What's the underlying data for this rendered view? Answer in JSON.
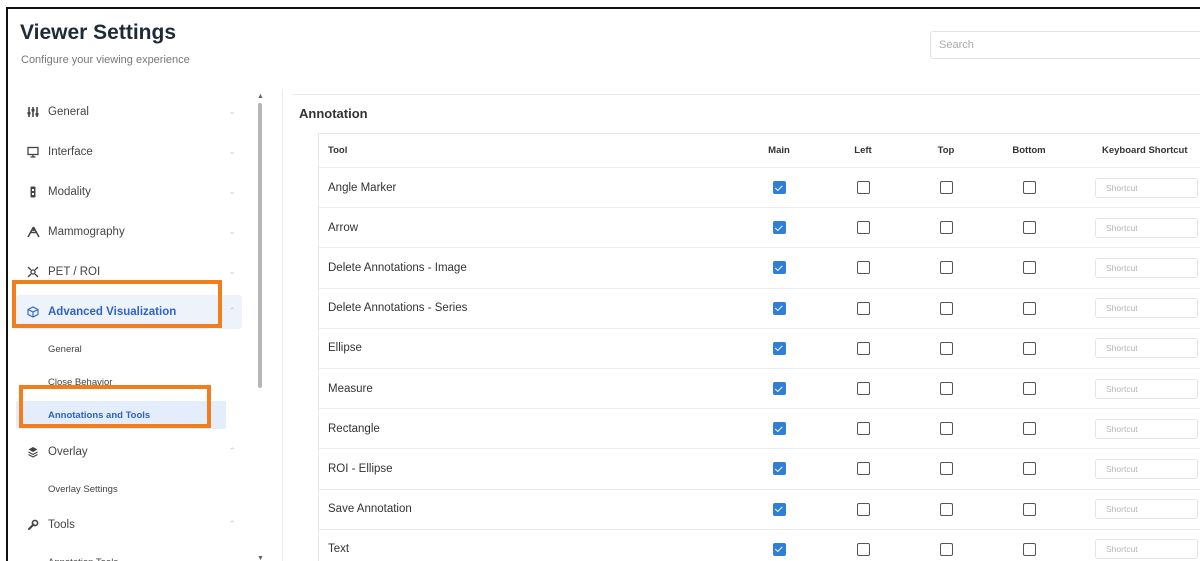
{
  "header": {
    "title": "Viewer Settings",
    "subtitle": "Configure your viewing experience",
    "search_placeholder": "Search"
  },
  "sidebar": {
    "items": [
      {
        "label": "General",
        "icon": "sliders-icon",
        "expanded": false
      },
      {
        "label": "Interface",
        "icon": "monitor-icon",
        "expanded": false
      },
      {
        "label": "Modality",
        "icon": "modality-icon",
        "expanded": false
      },
      {
        "label": "Mammography",
        "icon": "mammography-icon",
        "expanded": false
      },
      {
        "label": "PET / ROI",
        "icon": "pet-roi-icon",
        "expanded": false
      },
      {
        "label": "Advanced Visualization",
        "icon": "cube-icon",
        "expanded": true,
        "active": true
      },
      {
        "label": "Overlay",
        "icon": "overlay-icon",
        "expanded": true
      },
      {
        "label": "Tools",
        "icon": "wrench-icon",
        "expanded": true
      }
    ],
    "advanced_sub": [
      "General",
      "Close Behavior",
      "Annotations and Tools"
    ],
    "overlay_sub": [
      "Overlay Settings"
    ],
    "tools_sub": [
      "Annotation Tools"
    ],
    "active_sub": "Annotations and Tools"
  },
  "section": {
    "title": "Annotation"
  },
  "table": {
    "headers": {
      "tool": "Tool",
      "main": "Main",
      "left": "Left",
      "top": "Top",
      "bottom": "Bottom",
      "shortcut": "Keyboard Shortcut"
    },
    "shortcut_placeholder": "Shortcut",
    "rows": [
      {
        "tool": "Angle Marker",
        "main": true,
        "left": false,
        "top": false,
        "bottom": false
      },
      {
        "tool": "Arrow",
        "main": true,
        "left": false,
        "top": false,
        "bottom": false
      },
      {
        "tool": "Delete Annotations - Image",
        "main": true,
        "left": false,
        "top": false,
        "bottom": false
      },
      {
        "tool": "Delete Annotations - Series",
        "main": true,
        "left": false,
        "top": false,
        "bottom": false
      },
      {
        "tool": "Ellipse",
        "main": true,
        "left": false,
        "top": false,
        "bottom": false
      },
      {
        "tool": "Measure",
        "main": true,
        "left": false,
        "top": false,
        "bottom": false
      },
      {
        "tool": "Rectangle",
        "main": true,
        "left": false,
        "top": false,
        "bottom": false
      },
      {
        "tool": "ROI - Ellipse",
        "main": true,
        "left": false,
        "top": false,
        "bottom": false
      },
      {
        "tool": "Save Annotation",
        "main": true,
        "left": false,
        "top": false,
        "bottom": false
      },
      {
        "tool": "Text",
        "main": true,
        "left": false,
        "top": false,
        "bottom": false
      }
    ]
  },
  "colors": {
    "accent": "#2f63c4",
    "checkbox_checked": "#2f7fd6",
    "highlight_annotation": "#f07d1e"
  }
}
